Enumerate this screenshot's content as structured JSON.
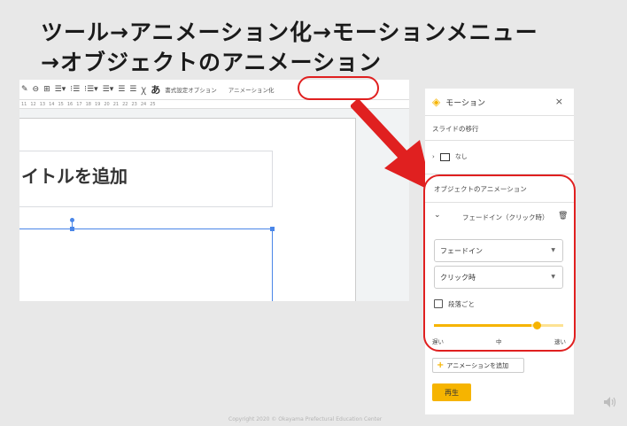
{
  "header": {
    "line1": "ツール→アニメーション化→モーションメニュー",
    "line2": "→オブジェクトのアニメーション"
  },
  "toolbar": {
    "items": [
      "✎",
      "⊖",
      "⊞",
      "☰▾",
      "⁝☰",
      "⁝☰▾",
      "☰▾",
      "☰",
      "☰",
      "Ꭓ"
    ],
    "bold_a": "あ",
    "format_options": "書式設定オプション",
    "animate": "アニメーション化"
  },
  "ruler": {
    "marks": [
      "11",
      "12",
      "13",
      "14",
      "15",
      "16",
      "17",
      "18",
      "19",
      "20",
      "21",
      "22",
      "23",
      "24",
      "25"
    ]
  },
  "slide": {
    "title_placeholder": "イトルを追加"
  },
  "panel": {
    "title": "モーション",
    "close": "×",
    "transition_label": "スライドの移行",
    "transition_value": "なし",
    "object_anim_label": "オブジェクトのアニメーション",
    "anim_item": "フェードイン（クリック時）",
    "effect_select": "フェードイン",
    "trigger_select": "クリック時",
    "by_paragraph": "段落ごと",
    "speed_slow": "遅い",
    "speed_medium": "中",
    "speed_fast": "速い",
    "speed_value": 0.8,
    "add_animation": "アニメーションを追加",
    "play": "再生"
  },
  "footer": {
    "copyright": "Copyright 2020 © Okayama Prefectural Education Center"
  },
  "colors": {
    "accent": "#f6b400",
    "highlight": "#e02020",
    "selection": "#4a86e8"
  }
}
